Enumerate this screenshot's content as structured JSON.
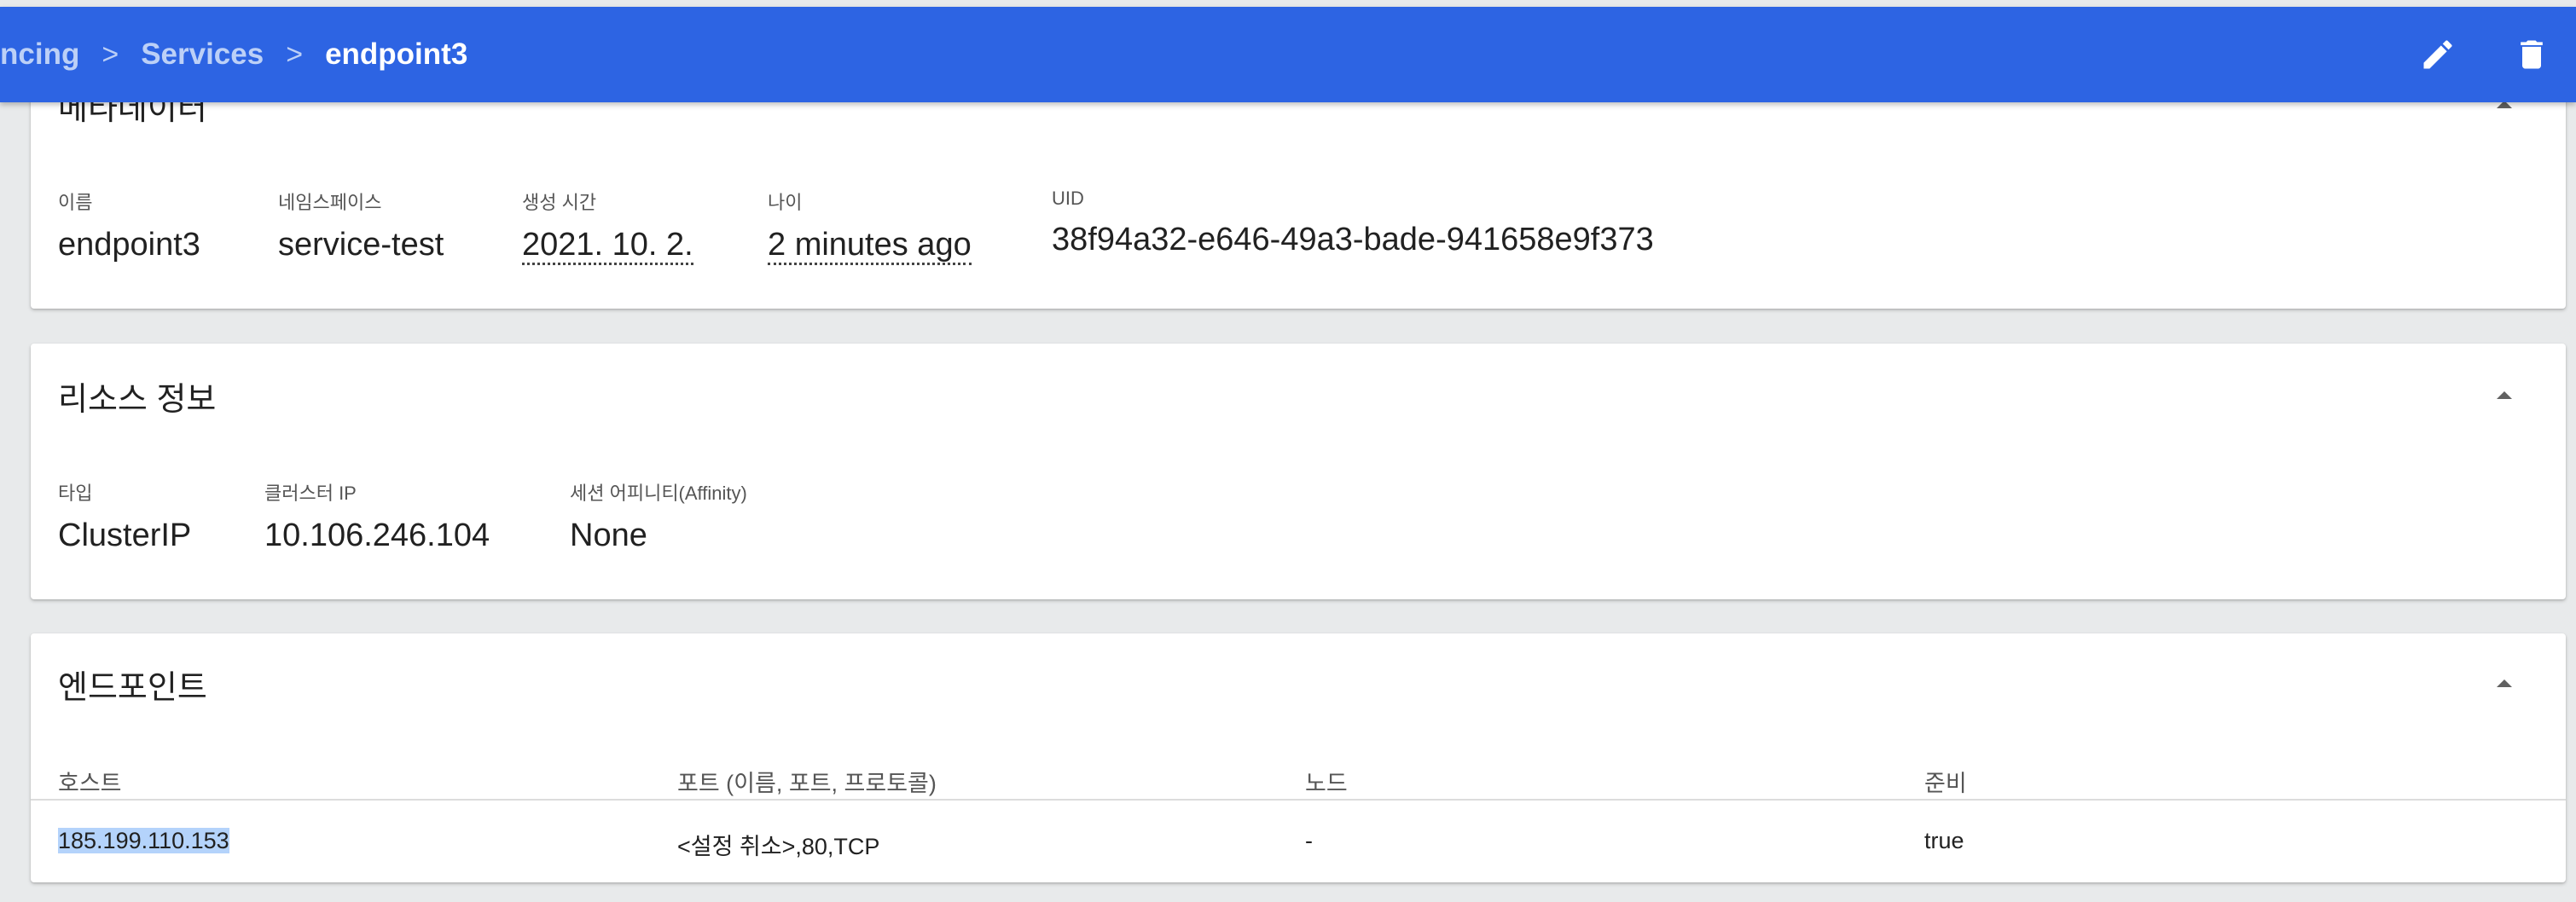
{
  "breadcrumb": {
    "items": [
      "ncing",
      "Services"
    ],
    "separator": ">",
    "current": "endpoint3"
  },
  "toolbar": {
    "edit_icon": "pencil-icon",
    "delete_icon": "trash-icon"
  },
  "metadata": {
    "title": "메타데이터",
    "fields": [
      {
        "label": "이름",
        "value": "endpoint3"
      },
      {
        "label": "네임스페이스",
        "value": "service-test"
      },
      {
        "label": "생성 시간",
        "value": "2021. 10. 2."
      },
      {
        "label": "나이",
        "value": "2 minutes ago"
      },
      {
        "label": "UID",
        "value": "38f94a32-e646-49a3-bade-941658e9f373"
      }
    ]
  },
  "resource": {
    "title": "리소스 정보",
    "fields": [
      {
        "label": "타입",
        "value": "ClusterIP"
      },
      {
        "label": "클러스터 IP",
        "value": "10.106.246.104"
      },
      {
        "label": "세션 어피니티(Affinity)",
        "value": "None"
      }
    ]
  },
  "endpoints": {
    "title": "엔드포인트",
    "columns": [
      "호스트",
      "포트 (이름, 포트, 프로토콜)",
      "노드",
      "준비"
    ],
    "rows": [
      [
        "185.199.110.153",
        "<설정 취소>,80,TCP",
        "-",
        "true"
      ]
    ]
  },
  "colors": {
    "topbar": "#2d64e3",
    "background": "#e8eaeb",
    "selection": "#b4d3fb"
  }
}
